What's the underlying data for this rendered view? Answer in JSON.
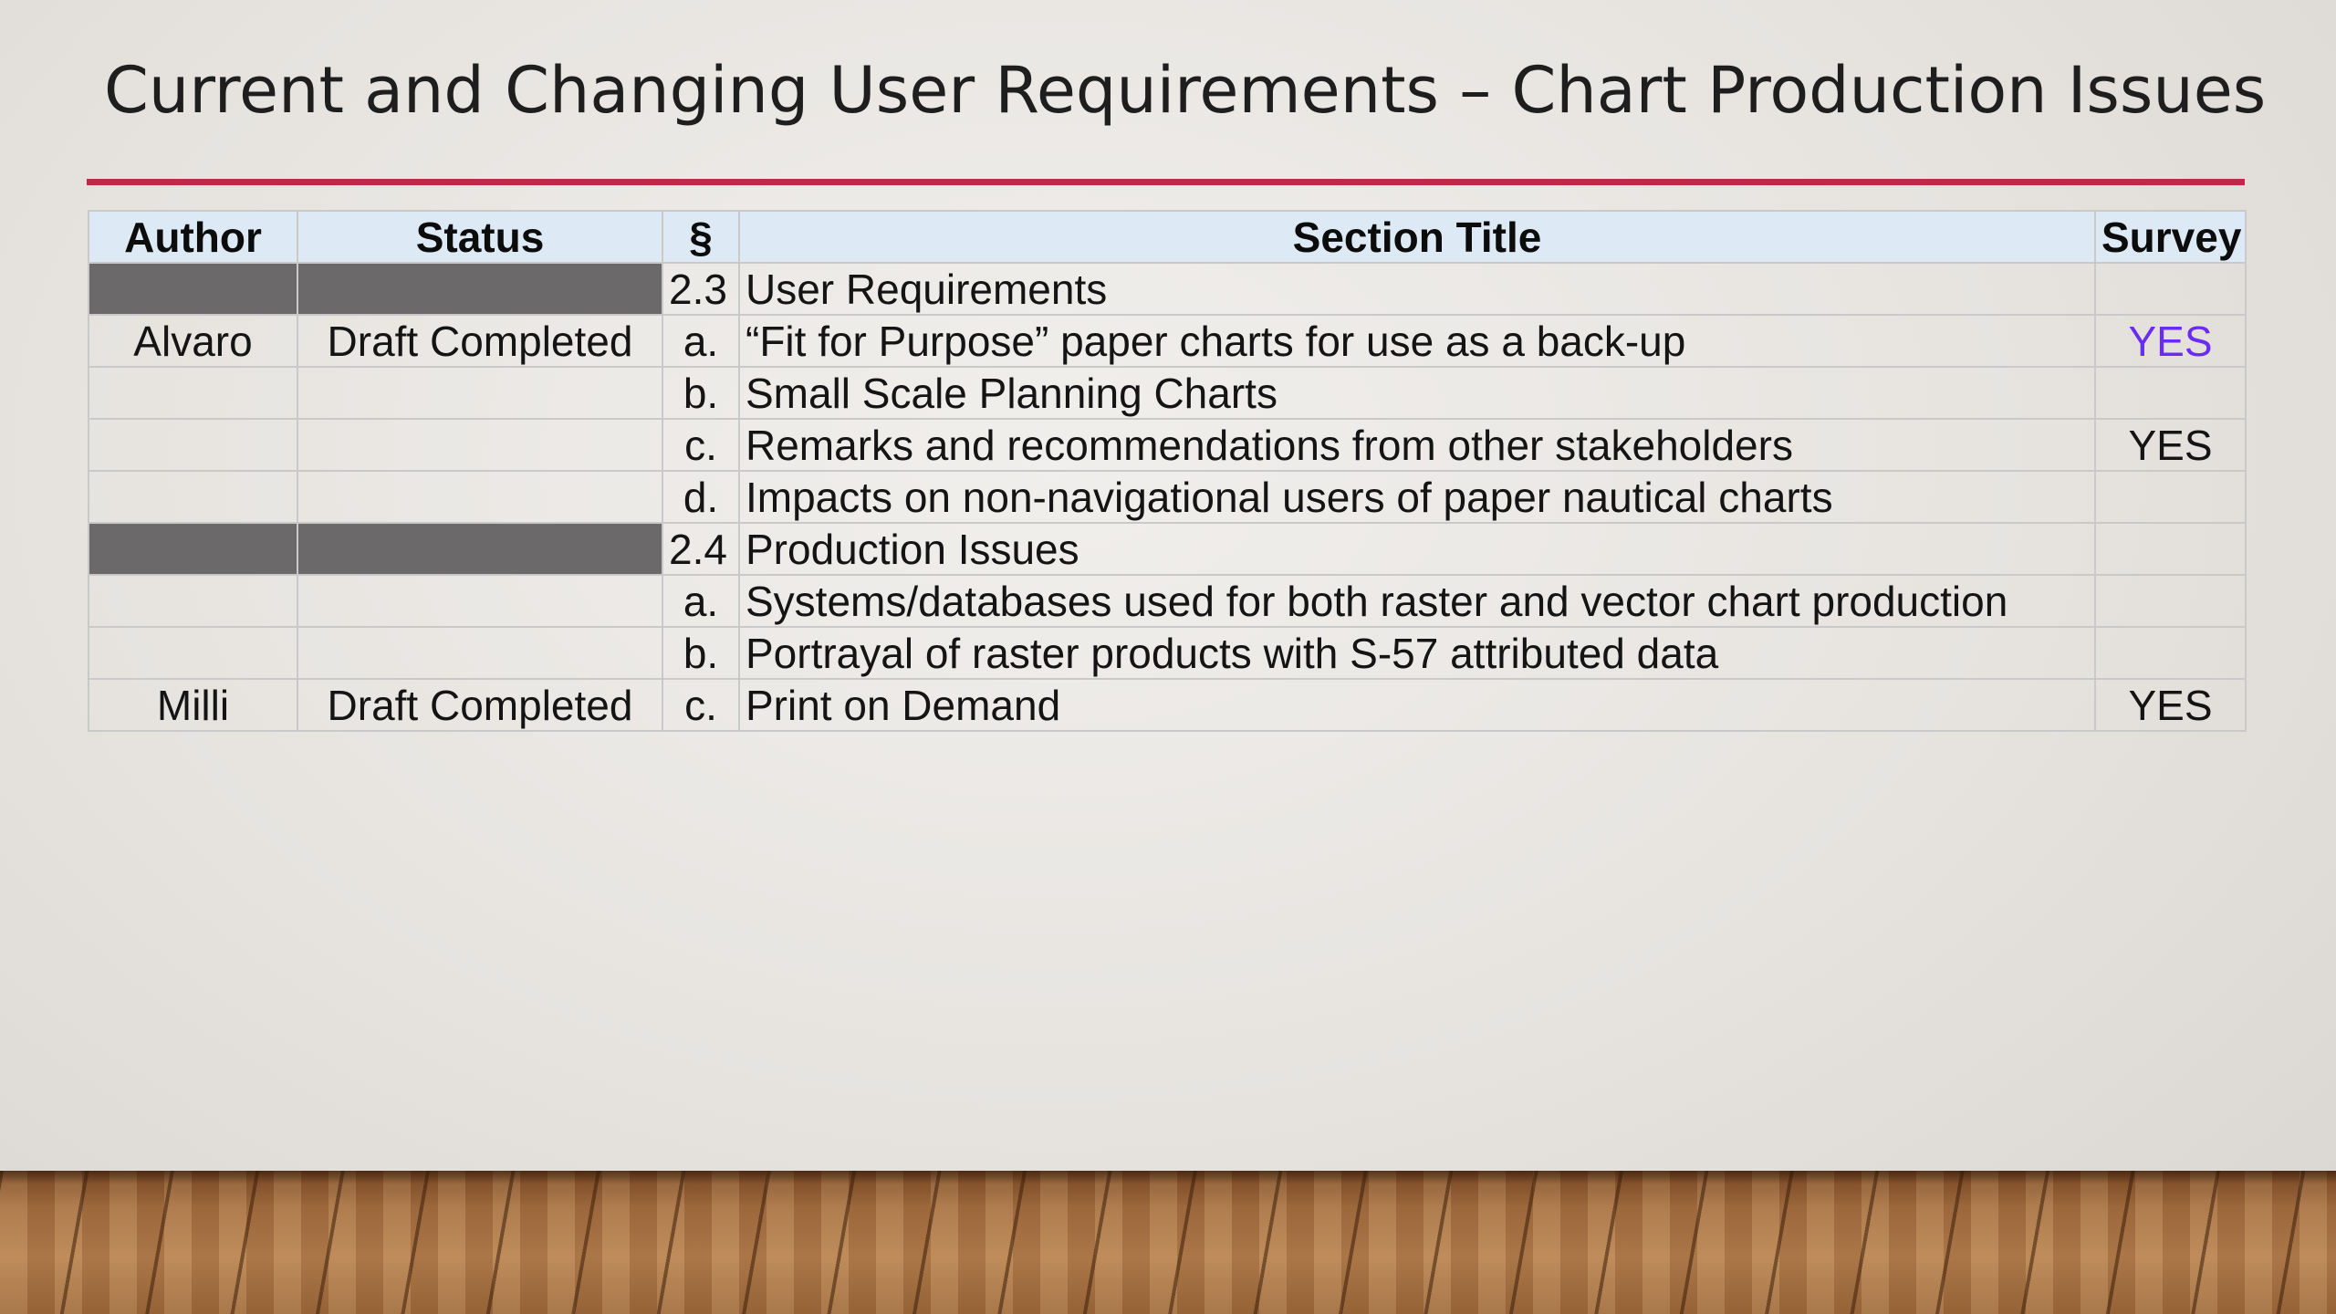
{
  "slide": {
    "title": "Current and Changing User Requirements – Chart Production Issues"
  },
  "table": {
    "headers": {
      "author": "Author",
      "status": "Status",
      "section": "§",
      "section_title": "Section Title",
      "survey": "Survey"
    },
    "rows": [
      {
        "type": "section",
        "author": "",
        "status": "",
        "num": "2.3",
        "title": "User Requirements",
        "survey": ""
      },
      {
        "type": "item",
        "author": "Alvaro",
        "status": "Draft Completed",
        "num": "a.",
        "title": "“Fit for Purpose” paper charts for use as a back-up",
        "survey": "YES"
      },
      {
        "type": "item",
        "author": "",
        "status": "",
        "num": "b.",
        "title": "Small Scale Planning Charts",
        "survey": ""
      },
      {
        "type": "item",
        "author": "",
        "status": "",
        "num": "c.",
        "title": "Remarks and recommendations from other stakeholders",
        "survey": "YES"
      },
      {
        "type": "item",
        "author": "",
        "status": "",
        "num": "d.",
        "title": "Impacts on non-navigational users of paper nautical charts",
        "survey": ""
      },
      {
        "type": "section",
        "author": "",
        "status": "",
        "num": "2.4",
        "title": "Production Issues",
        "survey": ""
      },
      {
        "type": "item",
        "author": "",
        "status": "",
        "num": "a.",
        "title": "Systems/databases used for both raster and vector chart production",
        "survey": ""
      },
      {
        "type": "item",
        "author": "",
        "status": "",
        "num": "b.",
        "title": "Portrayal of raster products with S-57 attributed data",
        "survey": ""
      },
      {
        "type": "item",
        "author": "Milli",
        "status": "Draft Completed",
        "num": "c.",
        "title": "Print on Demand",
        "survey": "YES"
      }
    ]
  },
  "colors": {
    "accent_rule": "#c0284a",
    "header_bg": "#dde9f4",
    "section_fill": "#6b6969",
    "survey_highlight": "#6a2cf0"
  }
}
